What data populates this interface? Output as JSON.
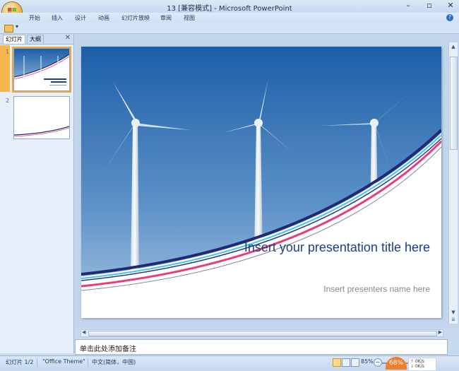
{
  "window": {
    "title": "13 [兼容模式] - Microsoft PowerPoint",
    "controls": [
      "–",
      "▫",
      "✕"
    ]
  },
  "ribbon_tabs": [
    "开始",
    "插入",
    "设计",
    "动画",
    "幻灯片放映",
    "审阅",
    "视图"
  ],
  "help_label": "?",
  "qat": {
    "dropdown": "▾"
  },
  "panel": {
    "tabs": [
      "幻灯片",
      "大纲"
    ],
    "close": "✕",
    "thumbnails": [
      {
        "number": "1",
        "selected": true
      },
      {
        "number": "2",
        "selected": false
      }
    ]
  },
  "slide": {
    "title": "Insert your presentation title here",
    "subtitle": "Insert presenters name here"
  },
  "notes": {
    "placeholder": "单击此处添加备注"
  },
  "statusbar": {
    "slide_counter": "幻灯片 1/2",
    "theme": "\"Office Theme\"",
    "language": "中文(简体，中国)",
    "zoom": "85%",
    "zoom_out": "−",
    "perf_badge": "68%",
    "net_up": "0K/s",
    "net_down": "0K/s"
  },
  "colors": {
    "title_text": "#1d3f8a",
    "stripe_navy": "#1f2a78",
    "stripe_pink": "#e83c7c",
    "stripe_cyan": "#42c5e6",
    "sky_top": "#1d5ea8",
    "sky_bottom": "#a9c7e3"
  }
}
